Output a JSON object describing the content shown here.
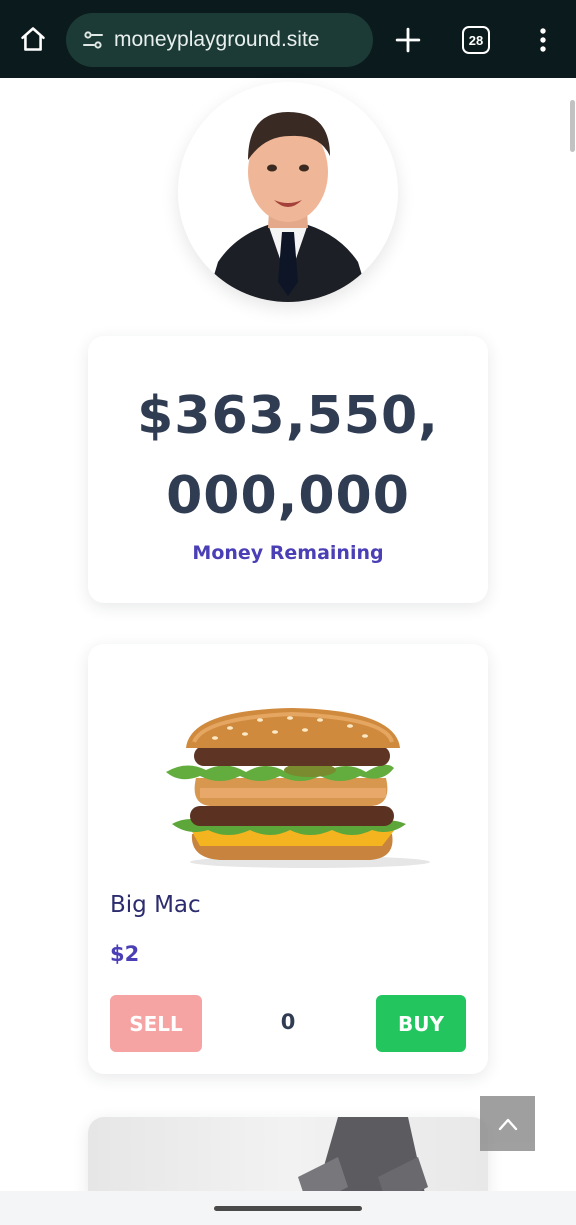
{
  "browser": {
    "url": "moneyplayground.site",
    "tab_count": "28",
    "icons": {
      "home": "home-icon",
      "site_settings": "tune-icon",
      "new_tab": "plus-icon",
      "tabs": "tabs-count-icon",
      "menu": "more-vert-icon"
    }
  },
  "balance": {
    "amount": "$363,550,000,000",
    "label": "Money Remaining"
  },
  "items": [
    {
      "name": "Big Mac",
      "price": "$2",
      "quantity": "0",
      "sell_label": "SELL",
      "buy_label": "BUY"
    }
  ],
  "colors": {
    "topbar_bg": "#0b1a1d",
    "url_pill_bg": "#1d3b36",
    "amount_text": "#2f3c52",
    "accent_purple": "#4a3fb5",
    "sell_button": "#f5a3a3",
    "buy_button": "#22c55e"
  },
  "scroll_to_top": {
    "icon": "chevron-up-icon"
  }
}
